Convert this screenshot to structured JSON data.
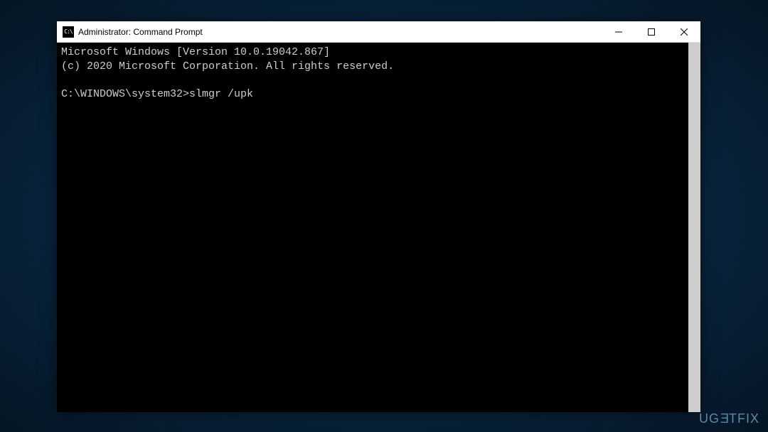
{
  "window": {
    "title": "Administrator: Command Prompt",
    "icon_label": "C:\\"
  },
  "terminal": {
    "line1": "Microsoft Windows [Version 10.0.19042.867]",
    "line2": "(c) 2020 Microsoft Corporation. All rights reserved.",
    "blank": "",
    "prompt": "C:\\WINDOWS\\system32>",
    "command": "slmgr /upk"
  },
  "watermark": {
    "part1": "UG",
    "part2": "E",
    "part3": "TFIX"
  }
}
